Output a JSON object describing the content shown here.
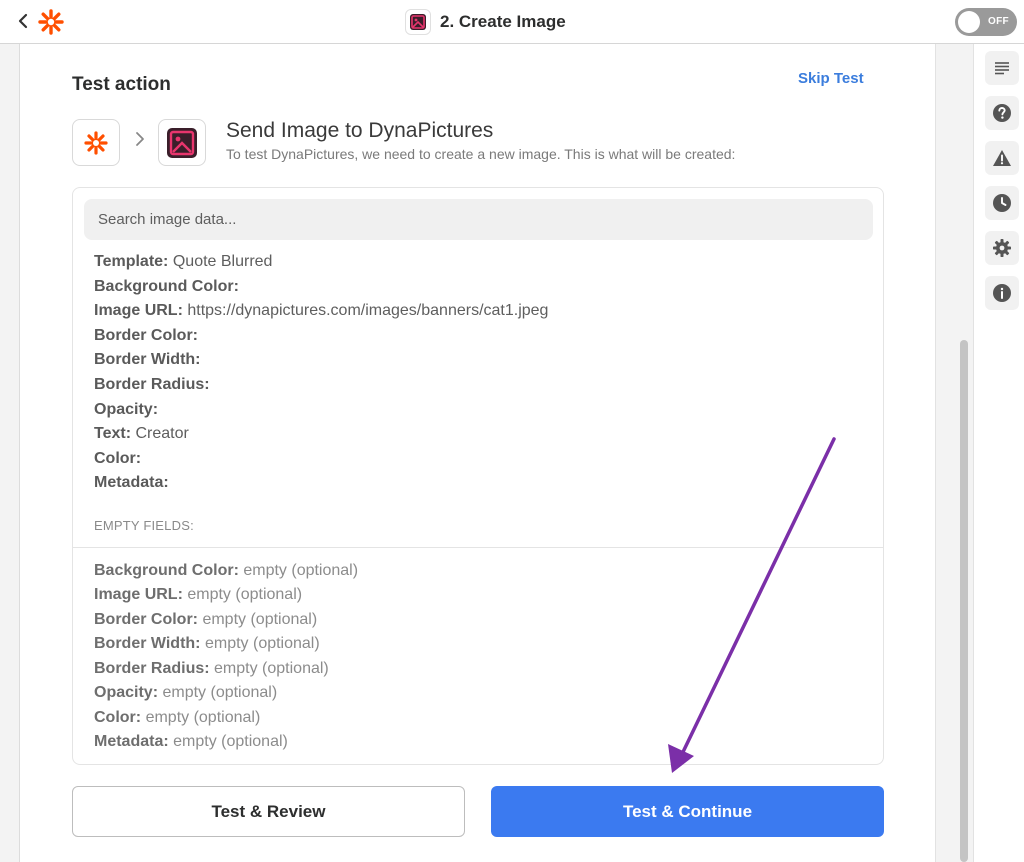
{
  "header": {
    "title": "2. Create Image",
    "toggle_label": "OFF"
  },
  "main": {
    "section_title": "Test action",
    "skip_label": "Skip Test",
    "step_title": "Send Image to DynaPictures",
    "step_subtitle": "To test DynaPictures, we need to create a new image. This is what will be created:",
    "search_placeholder": "Search image data...",
    "fields": [
      {
        "label": "Template:",
        "value": "Quote Blurred"
      },
      {
        "label": "Background Color:",
        "value": ""
      },
      {
        "label": "Image URL:",
        "value": "https://dynapictures.com/images/banners/cat1.jpeg"
      },
      {
        "label": "Border Color:",
        "value": ""
      },
      {
        "label": "Border Width:",
        "value": ""
      },
      {
        "label": "Border Radius:",
        "value": ""
      },
      {
        "label": "Opacity:",
        "value": ""
      },
      {
        "label": "Text:",
        "value": "Creator"
      },
      {
        "label": "Color:",
        "value": ""
      },
      {
        "label": "Metadata:",
        "value": ""
      }
    ],
    "empty_heading": "EMPTY FIELDS:",
    "empty_fields": [
      {
        "label": "Background Color:",
        "value": "empty (optional)"
      },
      {
        "label": "Image URL:",
        "value": "empty (optional)"
      },
      {
        "label": "Border Color:",
        "value": "empty (optional)"
      },
      {
        "label": "Border Width:",
        "value": "empty (optional)"
      },
      {
        "label": "Border Radius:",
        "value": "empty (optional)"
      },
      {
        "label": "Opacity:",
        "value": "empty (optional)"
      },
      {
        "label": "Color:",
        "value": "empty (optional)"
      },
      {
        "label": "Metadata:",
        "value": "empty (optional)"
      }
    ],
    "review_label": "Test & Review",
    "continue_label": "Test & Continue"
  },
  "sidebar": {
    "icons": [
      "details-icon",
      "help-icon",
      "alert-icon",
      "history-icon",
      "settings-icon",
      "info-icon"
    ]
  },
  "colors": {
    "zapier_orange": "#ff4f00",
    "primary_blue": "#3b7af0",
    "link_blue": "#3b7ddd",
    "dynapictures_pink": "#e8356d",
    "annotation_purple": "#7b2fa8"
  }
}
